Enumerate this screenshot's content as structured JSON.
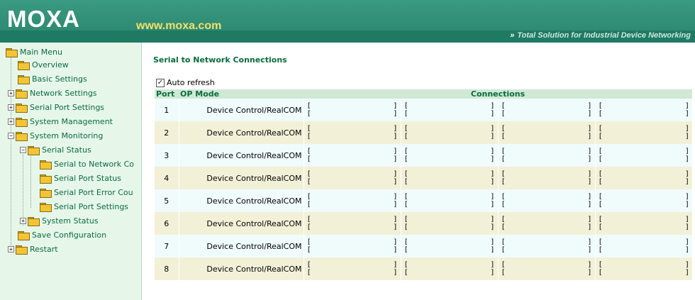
{
  "header": {
    "logo": "MOXA",
    "site": "www.moxa.com",
    "tagline_arrows": "»",
    "tagline": "Total Solution for Industrial Device Networking"
  },
  "sidebar": {
    "items": [
      {
        "label": "Main Menu",
        "expander": ""
      },
      {
        "label": "Overview",
        "expander": ""
      },
      {
        "label": "Basic Settings",
        "expander": ""
      },
      {
        "label": "Network Settings",
        "expander": "+"
      },
      {
        "label": "Serial Port Settings",
        "expander": "+"
      },
      {
        "label": "System Management",
        "expander": "+"
      },
      {
        "label": "System Monitoring",
        "expander": "−"
      },
      {
        "label": "Serial Status",
        "expander": "−"
      },
      {
        "label": "Serial to Network Co",
        "expander": ""
      },
      {
        "label": "Serial Port Status",
        "expander": ""
      },
      {
        "label": "Serial Port Error Cou",
        "expander": ""
      },
      {
        "label": "Serial Port Settings",
        "expander": ""
      },
      {
        "label": "System Status",
        "expander": "+"
      },
      {
        "label": "Save Configuration",
        "expander": ""
      },
      {
        "label": "Restart",
        "expander": "+"
      }
    ]
  },
  "main": {
    "title": "Serial to Network Connections",
    "auto_refresh": {
      "label": "Auto refresh",
      "checked": true
    },
    "columns": {
      "port": "Port",
      "mode": "OP Mode",
      "connections": "Connections"
    },
    "bracket_open": "[",
    "bracket_close": "]",
    "rows": [
      {
        "port": "1",
        "mode": "Device Control/RealCOM"
      },
      {
        "port": "2",
        "mode": "Device Control/RealCOM"
      },
      {
        "port": "3",
        "mode": "Device Control/RealCOM"
      },
      {
        "port": "4",
        "mode": "Device Control/RealCOM"
      },
      {
        "port": "5",
        "mode": "Device Control/RealCOM"
      },
      {
        "port": "6",
        "mode": "Device Control/RealCOM"
      },
      {
        "port": "7",
        "mode": "Device Control/RealCOM"
      },
      {
        "port": "8",
        "mode": "Device Control/RealCOM"
      }
    ]
  },
  "colors": {
    "header_green": "#2e8b73",
    "site_yellow": "#f3e06a",
    "sidebar_bg": "#e6f7ea",
    "link_green": "#0a6b3d"
  }
}
